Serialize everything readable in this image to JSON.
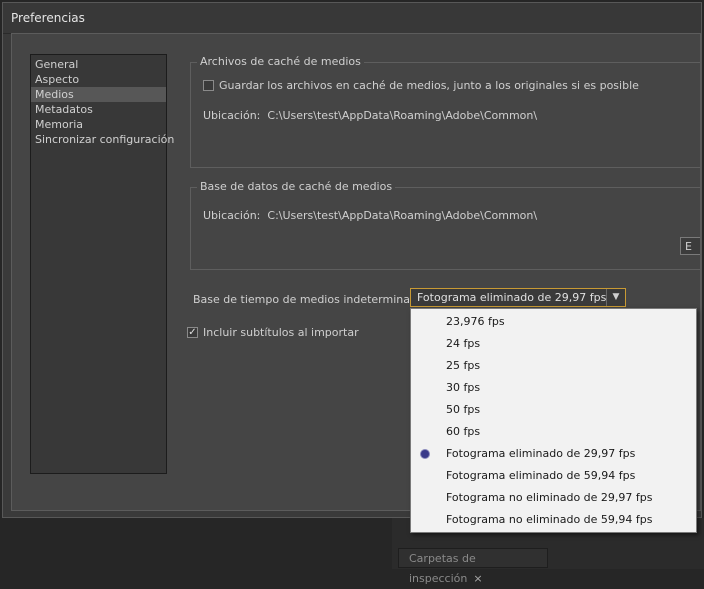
{
  "window": {
    "title": "Preferencias"
  },
  "sidebar": {
    "items": [
      {
        "label": "General"
      },
      {
        "label": "Aspecto"
      },
      {
        "label": "Medios"
      },
      {
        "label": "Metadatos"
      },
      {
        "label": "Memoria"
      },
      {
        "label": "Sincronizar configuración"
      }
    ],
    "selected": "Medios"
  },
  "media_cache_files": {
    "title": "Archivos de caché de medios",
    "save_with_originals_label": "Guardar los archivos  en caché de medios, junto a los originales si es posible",
    "save_with_originals_checked": false,
    "location_label": "Ubicación:",
    "location_value": "C:\\Users\\test\\AppData\\Roaming\\Adobe\\Common\\"
  },
  "media_cache_db": {
    "title": "Base de datos de caché de medios",
    "location_label": "Ubicación:",
    "location_value": "C:\\Users\\test\\AppData\\Roaming\\Adobe\\Common\\",
    "partial_button_label": "E"
  },
  "timebase": {
    "label": "Base de tiempo de medios  indeterminada:",
    "selected": "Fotograma eliminado de 29,97 fps",
    "options": [
      "23,976 fps",
      "24 fps",
      "25 fps",
      "30 fps",
      "50 fps",
      "60 fps",
      "Fotograma eliminado de 29,97 fps",
      "Fotograma eliminado de 59,94 fps",
      "Fotograma no eliminado de 29,97 fps",
      "Fotograma no eliminado de 59,94 fps"
    ]
  },
  "subtitles": {
    "label": "Incluir subtítulos al importar",
    "checked": true
  },
  "background": {
    "tab_label": "Carpetas de inspección",
    "tab_close": "×"
  },
  "colors": {
    "accent": "#c89a34",
    "radio": "#3a3a8a"
  }
}
